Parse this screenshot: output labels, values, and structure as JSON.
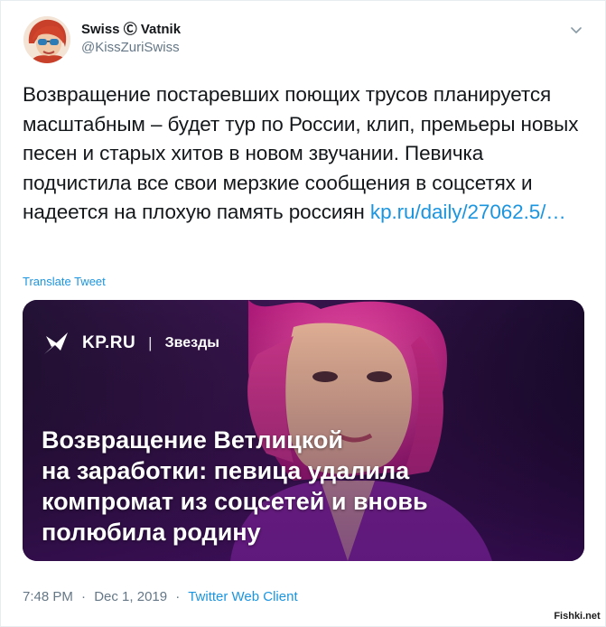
{
  "author": {
    "display_name": "Swiss Ⓒ Vatnik",
    "handle": "@KissZuriSwiss"
  },
  "tweet": {
    "text": "Возвращение постаревших поющих трусов планируется масштабным – будет тур по России, клип, премьеры новых песен и старых хитов в новом звучании. Певичка подчистила все свои мерзкие сообщения в соцсетях и надеется на плохую память россиян",
    "link_text": "kp.ru/daily/27062.5/…",
    "translate_label": "Translate Tweet"
  },
  "card": {
    "brand": "KP.RU",
    "separator": "|",
    "section": "Звезды",
    "headline_lines": [
      "Возвращение Ветлицкой",
      "на заработки: певица удалила",
      "компромат из соцсетей и вновь",
      "полюбила родину"
    ]
  },
  "meta": {
    "time": "7:48 PM",
    "dot": "·",
    "date": "Dec 1, 2019",
    "client": "Twitter Web Client"
  },
  "watermark": "Fishki.net",
  "colors": {
    "link": "#1b95e0",
    "secondary_text": "#657786",
    "primary_text": "#14171a",
    "card_background": "#2a0f45"
  },
  "icons": {
    "caret": "chevron-down-icon",
    "kp_logo": "kp-bird-icon"
  }
}
